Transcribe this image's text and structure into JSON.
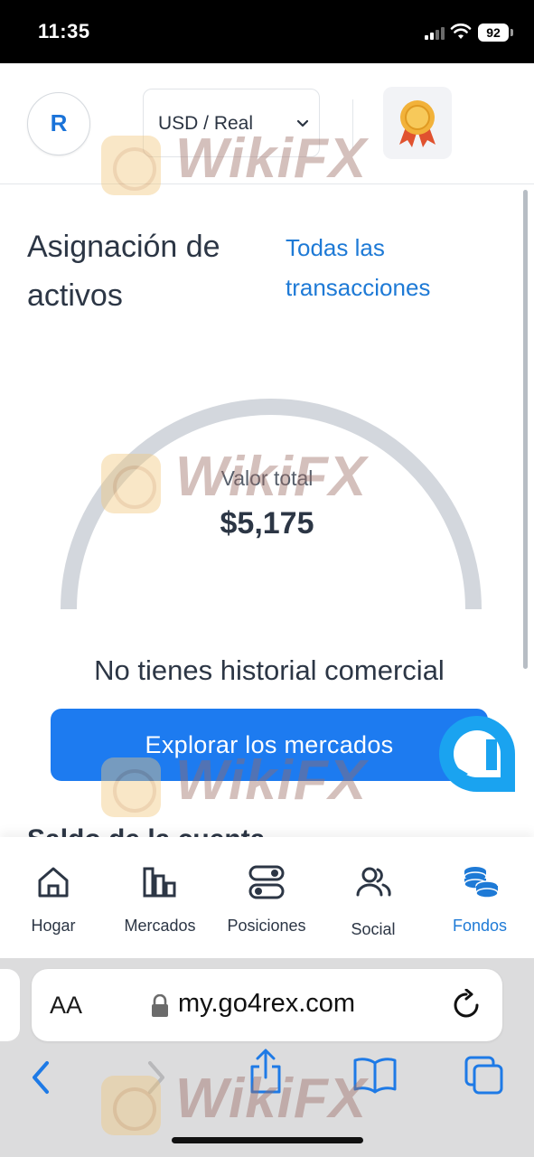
{
  "status_bar": {
    "time": "11:35",
    "battery": "92"
  },
  "header": {
    "avatar_initial": "R",
    "account_selector": "USD / Real"
  },
  "section": {
    "title": "Asignación de activos",
    "all_transactions_link": "Todas las transacciones"
  },
  "gauge": {
    "label": "Valor total",
    "value": "$5,175"
  },
  "empty_state": {
    "message": "No tienes historial comercial",
    "cta_label": "Explorar los mercados"
  },
  "next_section_peek": "Saldo de la cuenta",
  "bottom_nav": [
    {
      "label": "Hogar",
      "icon": "home-icon",
      "active": false
    },
    {
      "label": "Mercados",
      "icon": "bar-chart-icon",
      "active": false
    },
    {
      "label": "Posiciones",
      "icon": "toggles-icon",
      "active": false
    },
    {
      "label": "Social",
      "icon": "users-icon",
      "active": false
    },
    {
      "label": "Fondos",
      "icon": "coins-stack-icon",
      "active": true
    }
  ],
  "browser": {
    "text_size_label": "AA",
    "url": "my.go4rex.com"
  },
  "watermark": "WikiFX",
  "colors": {
    "accent": "#1e7ad6",
    "button": "#1d7bf0",
    "text": "#2c3645",
    "gauge_track": "#d3d7dd",
    "chat": "#1aa3f0"
  }
}
